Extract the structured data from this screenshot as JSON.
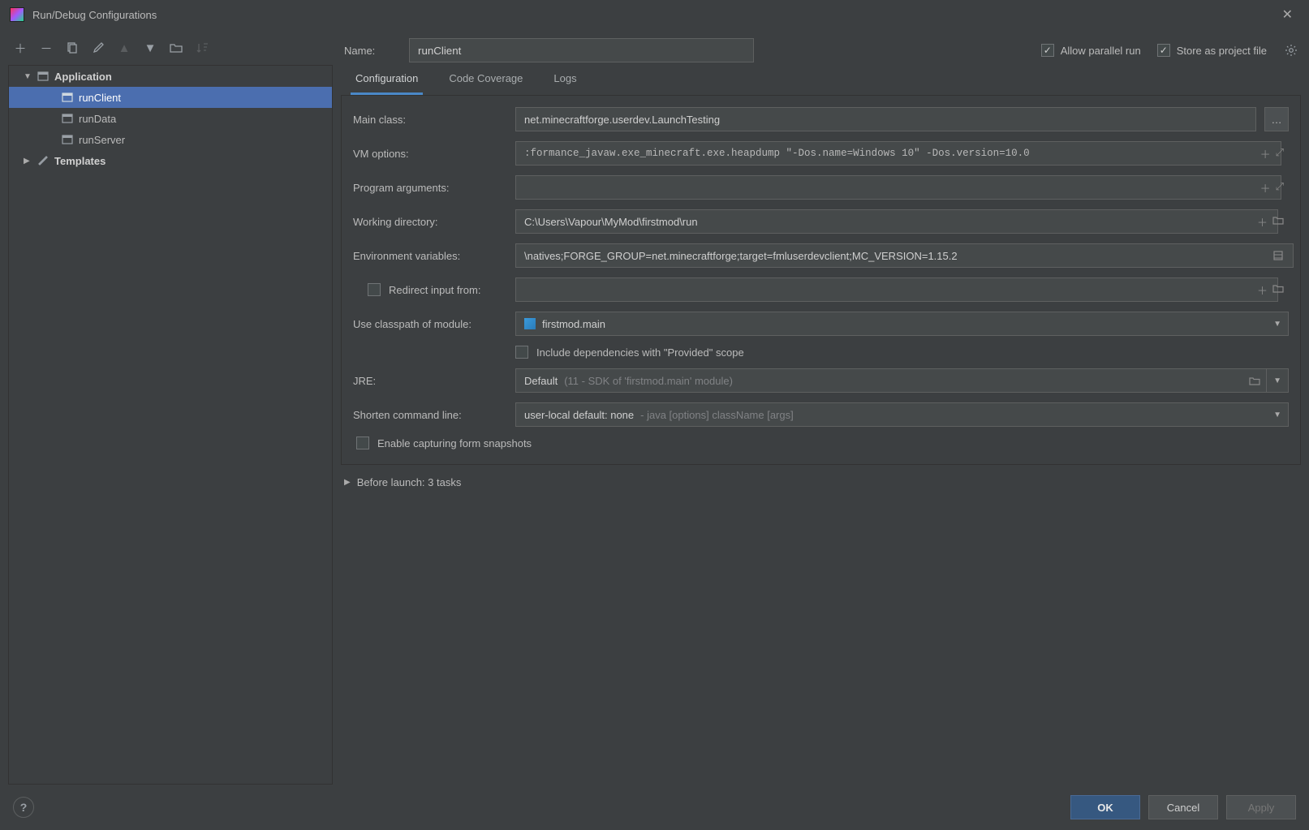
{
  "window": {
    "title": "Run/Debug Configurations"
  },
  "tree": {
    "application_label": "Application",
    "items": [
      "runClient",
      "runData",
      "runServer"
    ],
    "templates_label": "Templates"
  },
  "header": {
    "name_label": "Name:",
    "name_value": "runClient",
    "allow_parallel_label": "Allow parallel run",
    "store_as_project_label": "Store as project file"
  },
  "tabs": {
    "configuration": "Configuration",
    "code_coverage": "Code Coverage",
    "logs": "Logs"
  },
  "form": {
    "main_class_label": "Main class:",
    "main_class_value": "net.minecraftforge.userdev.LaunchTesting",
    "vm_options_label": "VM options:",
    "vm_options_value": ":formance_javaw.exe_minecraft.exe.heapdump \"-Dos.name=Windows 10\" -Dos.version=10.0",
    "program_args_label": "Program arguments:",
    "program_args_value": "",
    "working_dir_label": "Working directory:",
    "working_dir_value": "C:\\Users\\Vapour\\MyMod\\firstmod\\run",
    "env_vars_label": "Environment variables:",
    "env_vars_value": "\\natives;FORGE_GROUP=net.minecraftforge;target=fmluserdevclient;MC_VERSION=1.15.2",
    "redirect_label": "Redirect input from:",
    "classpath_label": "Use classpath of module:",
    "classpath_value": "firstmod.main",
    "include_provided_label": "Include dependencies with \"Provided\" scope",
    "jre_label": "JRE:",
    "jre_value": "Default",
    "jre_hint": "(11 - SDK of 'firstmod.main' module)",
    "shorten_label": "Shorten command line:",
    "shorten_value": "user-local default: none",
    "shorten_hint": "- java [options] className [args]",
    "enable_snapshots_label": "Enable capturing form snapshots"
  },
  "before_launch": {
    "label": "Before launch: 3 tasks"
  },
  "footer": {
    "ok": "OK",
    "cancel": "Cancel",
    "apply": "Apply"
  }
}
